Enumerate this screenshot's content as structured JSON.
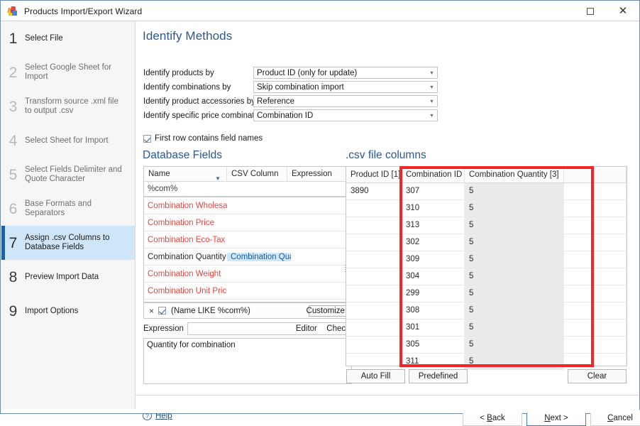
{
  "window": {
    "title": "Products Import/Export Wizard",
    "icon": "butterfly-app-icon",
    "maximize_label": "Maximize",
    "close_label": "Close"
  },
  "sidebar": {
    "steps": [
      {
        "num": "1",
        "label": "Select File",
        "state": "done"
      },
      {
        "num": "2",
        "label": "Select Google Sheet for Import",
        "state": "idle"
      },
      {
        "num": "3",
        "label": "Transform source .xml file to output .csv",
        "state": "idle"
      },
      {
        "num": "4",
        "label": "Select Sheet for Import",
        "state": "idle"
      },
      {
        "num": "5",
        "label": "Select Fields Delimiter and Quote Character",
        "state": "idle"
      },
      {
        "num": "6",
        "label": "Base Formats and Separators",
        "state": "idle"
      },
      {
        "num": "7",
        "label": "Assign .csv Columns to Database Fields",
        "state": "active"
      },
      {
        "num": "8",
        "label": "Preview Import Data",
        "state": "done"
      },
      {
        "num": "9",
        "label": "Import Options",
        "state": "done"
      }
    ]
  },
  "identify": {
    "heading": "Identify Methods",
    "rows": [
      {
        "label": "Identify products by",
        "value": "Product ID (only for update)"
      },
      {
        "label": "Identify combinations by",
        "value": "Skip combination import"
      },
      {
        "label": "Identify product accessories by",
        "value": "Reference"
      },
      {
        "label": "Identify specific price combination by",
        "value": "Combination ID"
      }
    ],
    "firstrow_checkbox": {
      "label": "First row contains field names",
      "checked": true
    }
  },
  "database_fields": {
    "heading": "Database Fields",
    "columns": [
      "Name",
      "CSV Column",
      "Expression"
    ],
    "sort_indicator": "filter-sort-icon",
    "filter_row_value": "%com%",
    "rows": [
      {
        "name": "Combination Wholesale",
        "csv": "",
        "expr": "",
        "required": true,
        "selected": false
      },
      {
        "name": "Combination Price",
        "csv": "",
        "expr": "",
        "required": true,
        "selected": false
      },
      {
        "name": "Combination Eco-Tax",
        "csv": "",
        "expr": "",
        "required": true,
        "selected": false
      },
      {
        "name": "Combination Quantity",
        "csv": "Combination Quantit",
        "expr": "",
        "required": false,
        "selected": true
      },
      {
        "name": "Combination Weight",
        "csv": "",
        "expr": "",
        "required": true,
        "selected": false
      },
      {
        "name": "Combination Unit Price",
        "csv": "",
        "expr": "",
        "required": true,
        "selected": false
      }
    ],
    "filter_bar": {
      "close": "×",
      "enabled": true,
      "expression": "(Name LIKE %com%)",
      "customize_label": "Customize..."
    },
    "expression": {
      "label": "Expression",
      "value": "",
      "editor_label": "Editor",
      "check_label": "Check"
    },
    "description": "Quantity for combination"
  },
  "csv_columns": {
    "heading": ".csv file columns",
    "columns": [
      "Product ID [1]",
      "Combination ID [2]",
      "Combination Quantity [3]"
    ],
    "rows": [
      {
        "product_id": "3890",
        "combination_id": "307",
        "combination_qty": "5"
      },
      {
        "product_id": "",
        "combination_id": "310",
        "combination_qty": "5"
      },
      {
        "product_id": "",
        "combination_id": "313",
        "combination_qty": "5"
      },
      {
        "product_id": "",
        "combination_id": "302",
        "combination_qty": "5"
      },
      {
        "product_id": "",
        "combination_id": "309",
        "combination_qty": "5"
      },
      {
        "product_id": "",
        "combination_id": "304",
        "combination_qty": "5"
      },
      {
        "product_id": "",
        "combination_id": "299",
        "combination_qty": "5"
      },
      {
        "product_id": "",
        "combination_id": "308",
        "combination_qty": "5"
      },
      {
        "product_id": "",
        "combination_id": "301",
        "combination_qty": "5"
      },
      {
        "product_id": "",
        "combination_id": "305",
        "combination_qty": "5"
      },
      {
        "product_id": "",
        "combination_id": "311",
        "combination_qty": "5"
      }
    ],
    "buttons": {
      "auto_fill": "Auto Fill",
      "predefined": "Predefined",
      "clear": "Clear"
    },
    "highlight_color": "#f5232a"
  },
  "footer": {
    "help": "Help",
    "back": "< Back",
    "next": "Next >",
    "cancel": "Cancel"
  },
  "colors": {
    "accent": "#2b5797",
    "required_field": "#f0413c",
    "selection": "#cfe8f8",
    "active_step": "#cfe6f9",
    "active_step_bar": "#1f5fa8"
  }
}
